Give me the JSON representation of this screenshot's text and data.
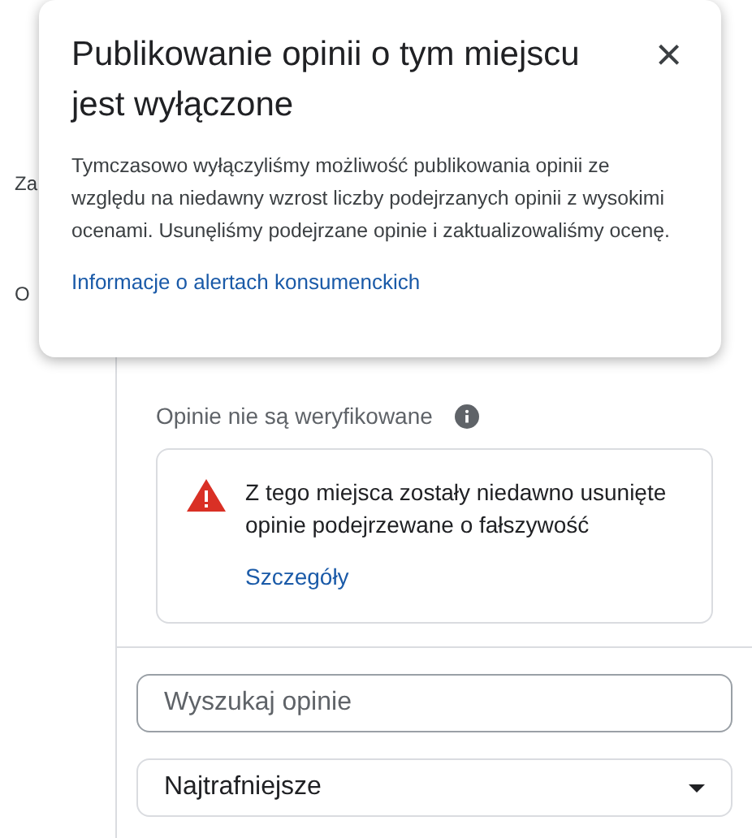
{
  "sidebar": {
    "items": [
      "Za",
      "O"
    ]
  },
  "popup": {
    "title": "Publikowanie opinii o tym miejscu jest wyłączone",
    "close": "×",
    "body": "Tymczasowo wyłączyliśmy możliwość publikowania opinii ze względu na niedawny wzrost liczby podejrzanych opinii z wysokimi ocenami. Usunęliśmy podejrzane opinie i zaktualizowaliśmy ocenę.",
    "link": "Informacje o alertach konsumenckich"
  },
  "reviews": {
    "notice": "Opinie nie są weryfikowane",
    "alert": {
      "text": "Z tego miejsca zostały niedawno usunięte opinie podejrzewane o fałszywość",
      "link": "Szczegóły"
    },
    "search": {
      "placeholder": "Wyszukaj opinie"
    },
    "sort": {
      "value": "Najtrafniejsze"
    }
  }
}
